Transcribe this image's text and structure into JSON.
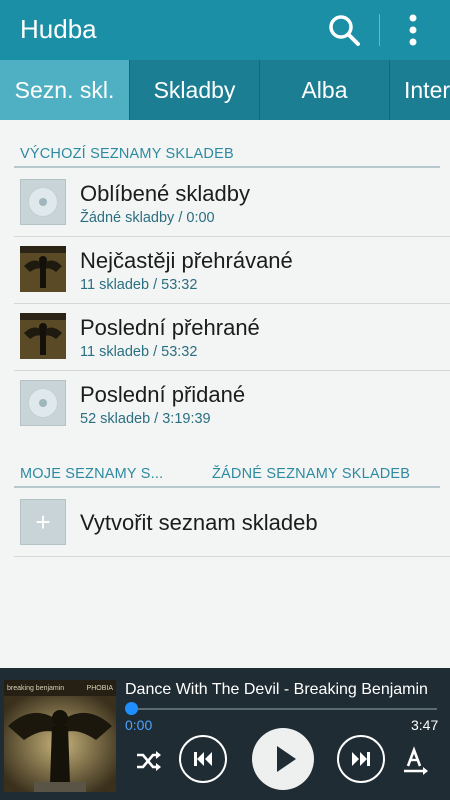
{
  "appbar": {
    "title": "Hudba",
    "icons": [
      "search-icon",
      "more-vert-icon"
    ]
  },
  "tabs": [
    {
      "label": "Sezn. skl.",
      "active": true
    },
    {
      "label": "Skladby",
      "active": false
    },
    {
      "label": "Alba",
      "active": false
    },
    {
      "label": "Interpreti",
      "active": false
    }
  ],
  "default_section": {
    "header": "VÝCHOZÍ SEZNAMY SKLADEB",
    "items": [
      {
        "title": "Oblíbené skladby",
        "subtitle": "Žádné skladby / 0:00",
        "thumb": "disc"
      },
      {
        "title": "Nejčastěji přehrávané",
        "subtitle": "11 skladeb / 53:32",
        "thumb": "album-art"
      },
      {
        "title": "Poslední přehrané",
        "subtitle": "11 skladeb / 53:32",
        "thumb": "album-art"
      },
      {
        "title": "Poslední přidané",
        "subtitle": "52 skladeb / 3:19:39",
        "thumb": "disc"
      }
    ]
  },
  "my_section": {
    "header": "MOJE SEZNAMY S...",
    "empty_label": "ŽÁDNÉ SEZNAMY SKLADEB",
    "create_label": "Vytvořit seznam skladeb"
  },
  "player": {
    "album_band_left": "breaking benjamin",
    "album_band_right": "PHOBIA",
    "track": "Dance With The Devil - Breaking Benjamin",
    "time_current": "0:00",
    "time_total": "3:47",
    "progress": 0.0,
    "controls": [
      "shuffle-icon",
      "previous-icon",
      "play-icon",
      "next-icon",
      "font-size-icon"
    ]
  },
  "colors": {
    "appbar": "#1a8fa6",
    "tabs": "#1b7e93",
    "tab_active": "#4fb0c3",
    "accent_text": "#2d8ba0",
    "player_bg": "#1f2c33",
    "progress_accent": "#1f8fff"
  }
}
